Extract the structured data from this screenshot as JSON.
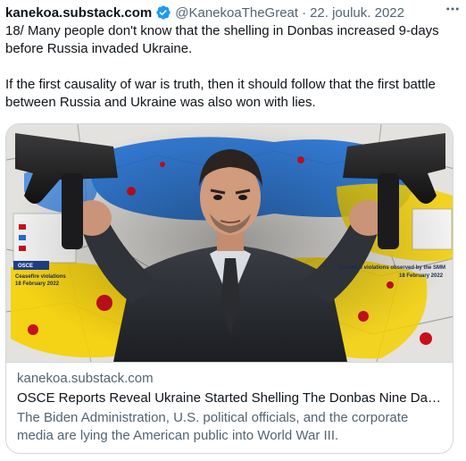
{
  "tweet": {
    "author_name": "kanekoa.substack.com",
    "handle": "@KanekoaTheGreat",
    "separator": "·",
    "date": "22. jouluk. 2022",
    "text": "18/ Many people don't know that the shelling in Donbas increased 9-days before Russia invaded Ukraine.\n\nIf the first causality of war is truth, then it should follow that the first battle between Russia and Ukraine was also won with lies."
  },
  "card": {
    "domain": "kanekoa.substack.com",
    "title": "OSCE Reports Reveal Ukraine Started Shelling The Donbas Nine Day...",
    "description": "The Biden Administration, U.S. political officials, and the corporate media are lying the American public into World War III.",
    "image": {
      "labels": {
        "osce": "OSCE",
        "left_caption": "Ceasefire violations",
        "left_date": "18 February 2022",
        "right_caption": "Ceasefire violations observed by the SMM",
        "right_date": "18 February 2022"
      }
    }
  },
  "colors": {
    "verified_blue": "#1d9bf0",
    "text_primary": "#0f1419",
    "text_secondary": "#536471",
    "border": "#cfd9de",
    "flag_blue": "#1f6fd1",
    "flag_yellow": "#f5d000",
    "blood_red": "#c8101c"
  },
  "icons": {
    "verified": "verified-badge-icon",
    "more": "more-horizontal-icon"
  }
}
